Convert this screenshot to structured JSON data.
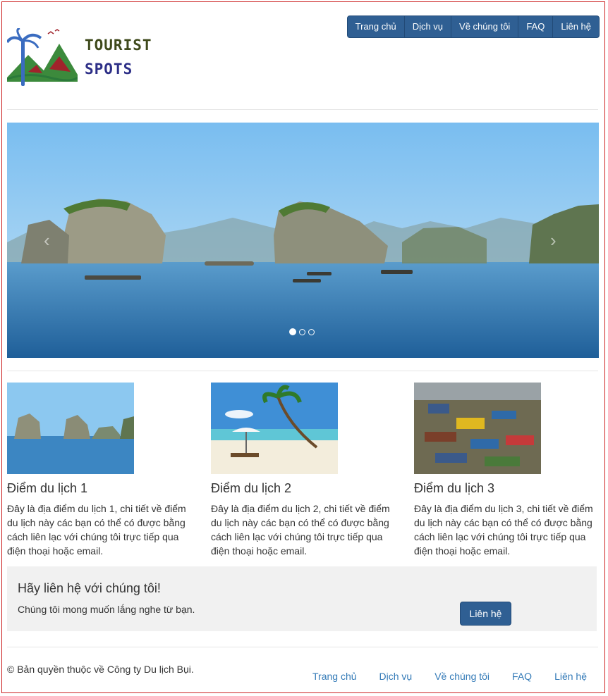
{
  "logo": {
    "line1": "TOURIST",
    "line2": "SPOTS"
  },
  "nav": {
    "items": [
      "Trang chủ",
      "Dịch vụ",
      "Về chúng tôi",
      "FAQ",
      "Liên hệ"
    ]
  },
  "carousel": {
    "prev_glyph": "‹",
    "next_glyph": "›",
    "slide_count": 3,
    "active_slide": 1
  },
  "cards": [
    {
      "title": "Điểm du lịch 1",
      "text": "Đây là địa điểm du lịch 1, chi tiết về điểm du lịch này các bạn có thể có được bằng cách liên lạc với chúng tôi trực tiếp qua điện thoại hoặc email."
    },
    {
      "title": "Điểm du lịch 2",
      "text": "Đây là địa điểm du lịch 2, chi tiết về điểm du lịch này các bạn có thể có được bằng cách liên lạc với chúng tôi trực tiếp qua điện thoại hoặc email."
    },
    {
      "title": "Điểm du lịch 3",
      "text": "Đây là địa điểm du lịch 3, chi tiết về điểm du lịch này các bạn có thể có được bằng cách liên lạc với chúng tôi trực tiếp qua điện thoại hoặc email."
    }
  ],
  "contact": {
    "heading": "Hãy liên hệ với chúng tôi!",
    "text": "Chúng tôi mong muốn lắng nghe từ bạn.",
    "button": "Liên hệ"
  },
  "footer": {
    "copyright": "© Bản quyền thuộc về Công ty Du lịch Bụi.",
    "links": [
      "Trang chủ",
      "Dịch vụ",
      "Về chúng tôi",
      "FAQ",
      "Liên hệ"
    ]
  },
  "colors": {
    "primary": "#2f5f93",
    "link": "#337ab7",
    "frame": "#cc2222",
    "panel": "#f1f1f1"
  }
}
